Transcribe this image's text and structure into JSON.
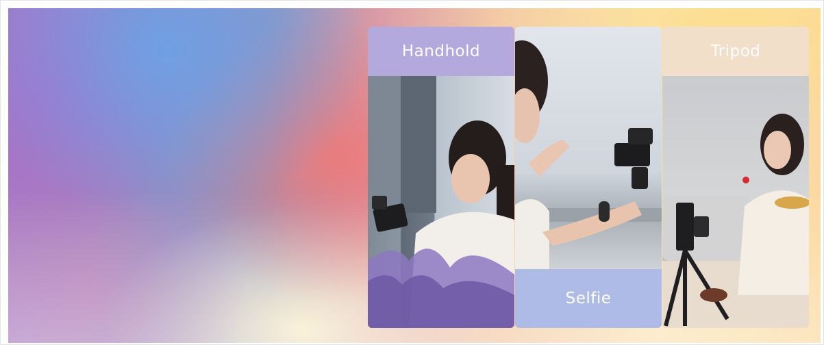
{
  "panels": {
    "handhold": {
      "label": "Handhold"
    },
    "selfie": {
      "label": "Selfie"
    },
    "tripod": {
      "label": "Tripod"
    }
  },
  "colors": {
    "handhold_band": "#b3a9dc",
    "selfie_band": "#aebbe6",
    "tripod_band": "#f1dfca",
    "label_text": "#ffffff"
  }
}
